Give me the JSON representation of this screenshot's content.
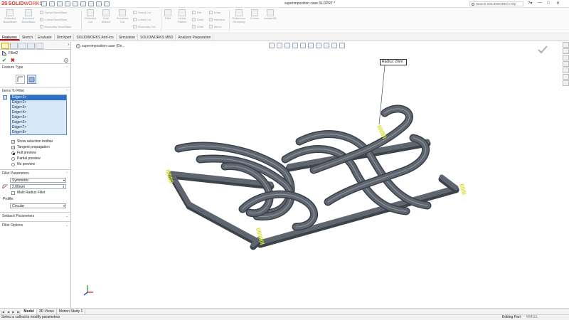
{
  "app": {
    "brand_prefix": "3S",
    "brand_solid": "SOLID",
    "brand_works": "WORKS",
    "document_title": "superimposition case.SLDPRT *",
    "search_placeholder": "Search SOLIDWORKS Help"
  },
  "ribbon": {
    "large_buttons": [
      {
        "label": "Extruded Boss/Base",
        "icon": "extrude-boss-icon"
      },
      {
        "label": "Revolved Boss/Base",
        "icon": "revolve-boss-icon"
      },
      {
        "label": "Extruded Cut",
        "icon": "extrude-cut-icon"
      },
      {
        "label": "Hole Wizard",
        "icon": "hole-wizard-icon"
      },
      {
        "label": "Revolved Cut",
        "icon": "revolve-cut-icon"
      },
      {
        "label": "Fillet",
        "icon": "fillet-icon"
      },
      {
        "label": "Linear Pattern",
        "icon": "linear-pattern-icon"
      },
      {
        "label": "Reference Geometry",
        "icon": "reference-geometry-icon"
      },
      {
        "label": "Curves",
        "icon": "curves-icon"
      },
      {
        "label": "Instant3D",
        "icon": "instant3d-icon"
      }
    ],
    "small_buttons": [
      {
        "label": "Swept Boss/Base",
        "icon": "swept-boss-icon"
      },
      {
        "label": "Lofted Boss/Base",
        "icon": "lofted-boss-icon"
      },
      {
        "label": "Boundary Boss/Base",
        "icon": "boundary-boss-icon"
      },
      {
        "label": "Swept Cut",
        "icon": "swept-cut-icon"
      },
      {
        "label": "Lofted Cut",
        "icon": "lofted-cut-icon"
      },
      {
        "label": "Boundary Cut",
        "icon": "boundary-cut-icon"
      },
      {
        "label": "Rib",
        "icon": "rib-icon"
      },
      {
        "label": "Draft",
        "icon": "draft-icon"
      },
      {
        "label": "Shell",
        "icon": "shell-icon"
      },
      {
        "label": "Wrap",
        "icon": "wrap-icon"
      },
      {
        "label": "Intersect",
        "icon": "intersect-icon"
      },
      {
        "label": "Mirror",
        "icon": "mirror-icon"
      }
    ]
  },
  "command_tabs": [
    "Features",
    "Sketch",
    "Evaluate",
    "DimXpert",
    "SOLIDWORKS Add-Ins",
    "Simulation",
    "SOLIDWORKS MBD",
    "Analysis Preparation"
  ],
  "property_manager": {
    "feature_name": "Fillet2",
    "help_label": "?",
    "ok_symbol": "✔",
    "cancel_symbol": "✖",
    "feature_type_label": "Feature Type",
    "items_label": "Items To Fillet",
    "edges": [
      "Edge<1>",
      "Edge<2>",
      "Edge<3>",
      "Edge<4>",
      "Edge<5>",
      "Edge<6>",
      "Edge<7>",
      "Edge<8>"
    ],
    "show_selection_toolbar": "Show selection toolbar",
    "tangent_propagation": "Tangent propagation",
    "full_preview": "Full preview",
    "partial_preview": "Partial preview",
    "no_preview": "No preview",
    "fillet_parameters_label": "Fillet Parameters",
    "method": "Symmetric",
    "radius_value": "2.00mm",
    "multi_radius": "Multi Radius Fillet",
    "profile_label": "Profile:",
    "profile_value": "Circular",
    "setback_label": "Setback Parameters",
    "options_label": "Fillet Options",
    "checked_symbol": "✓"
  },
  "viewport": {
    "breadcrumb": "superimposition case (De...",
    "callout": "Radius: 2mm",
    "body_color": "#5f6670",
    "edge_highlight_color": "#d8e02a"
  },
  "bottom_tabs": [
    "Model",
    "3D Views",
    "Motion Study 1"
  ],
  "status": {
    "message": "Select a callout to modify parameters",
    "mode": "Editing Part",
    "units": "MMGS"
  }
}
